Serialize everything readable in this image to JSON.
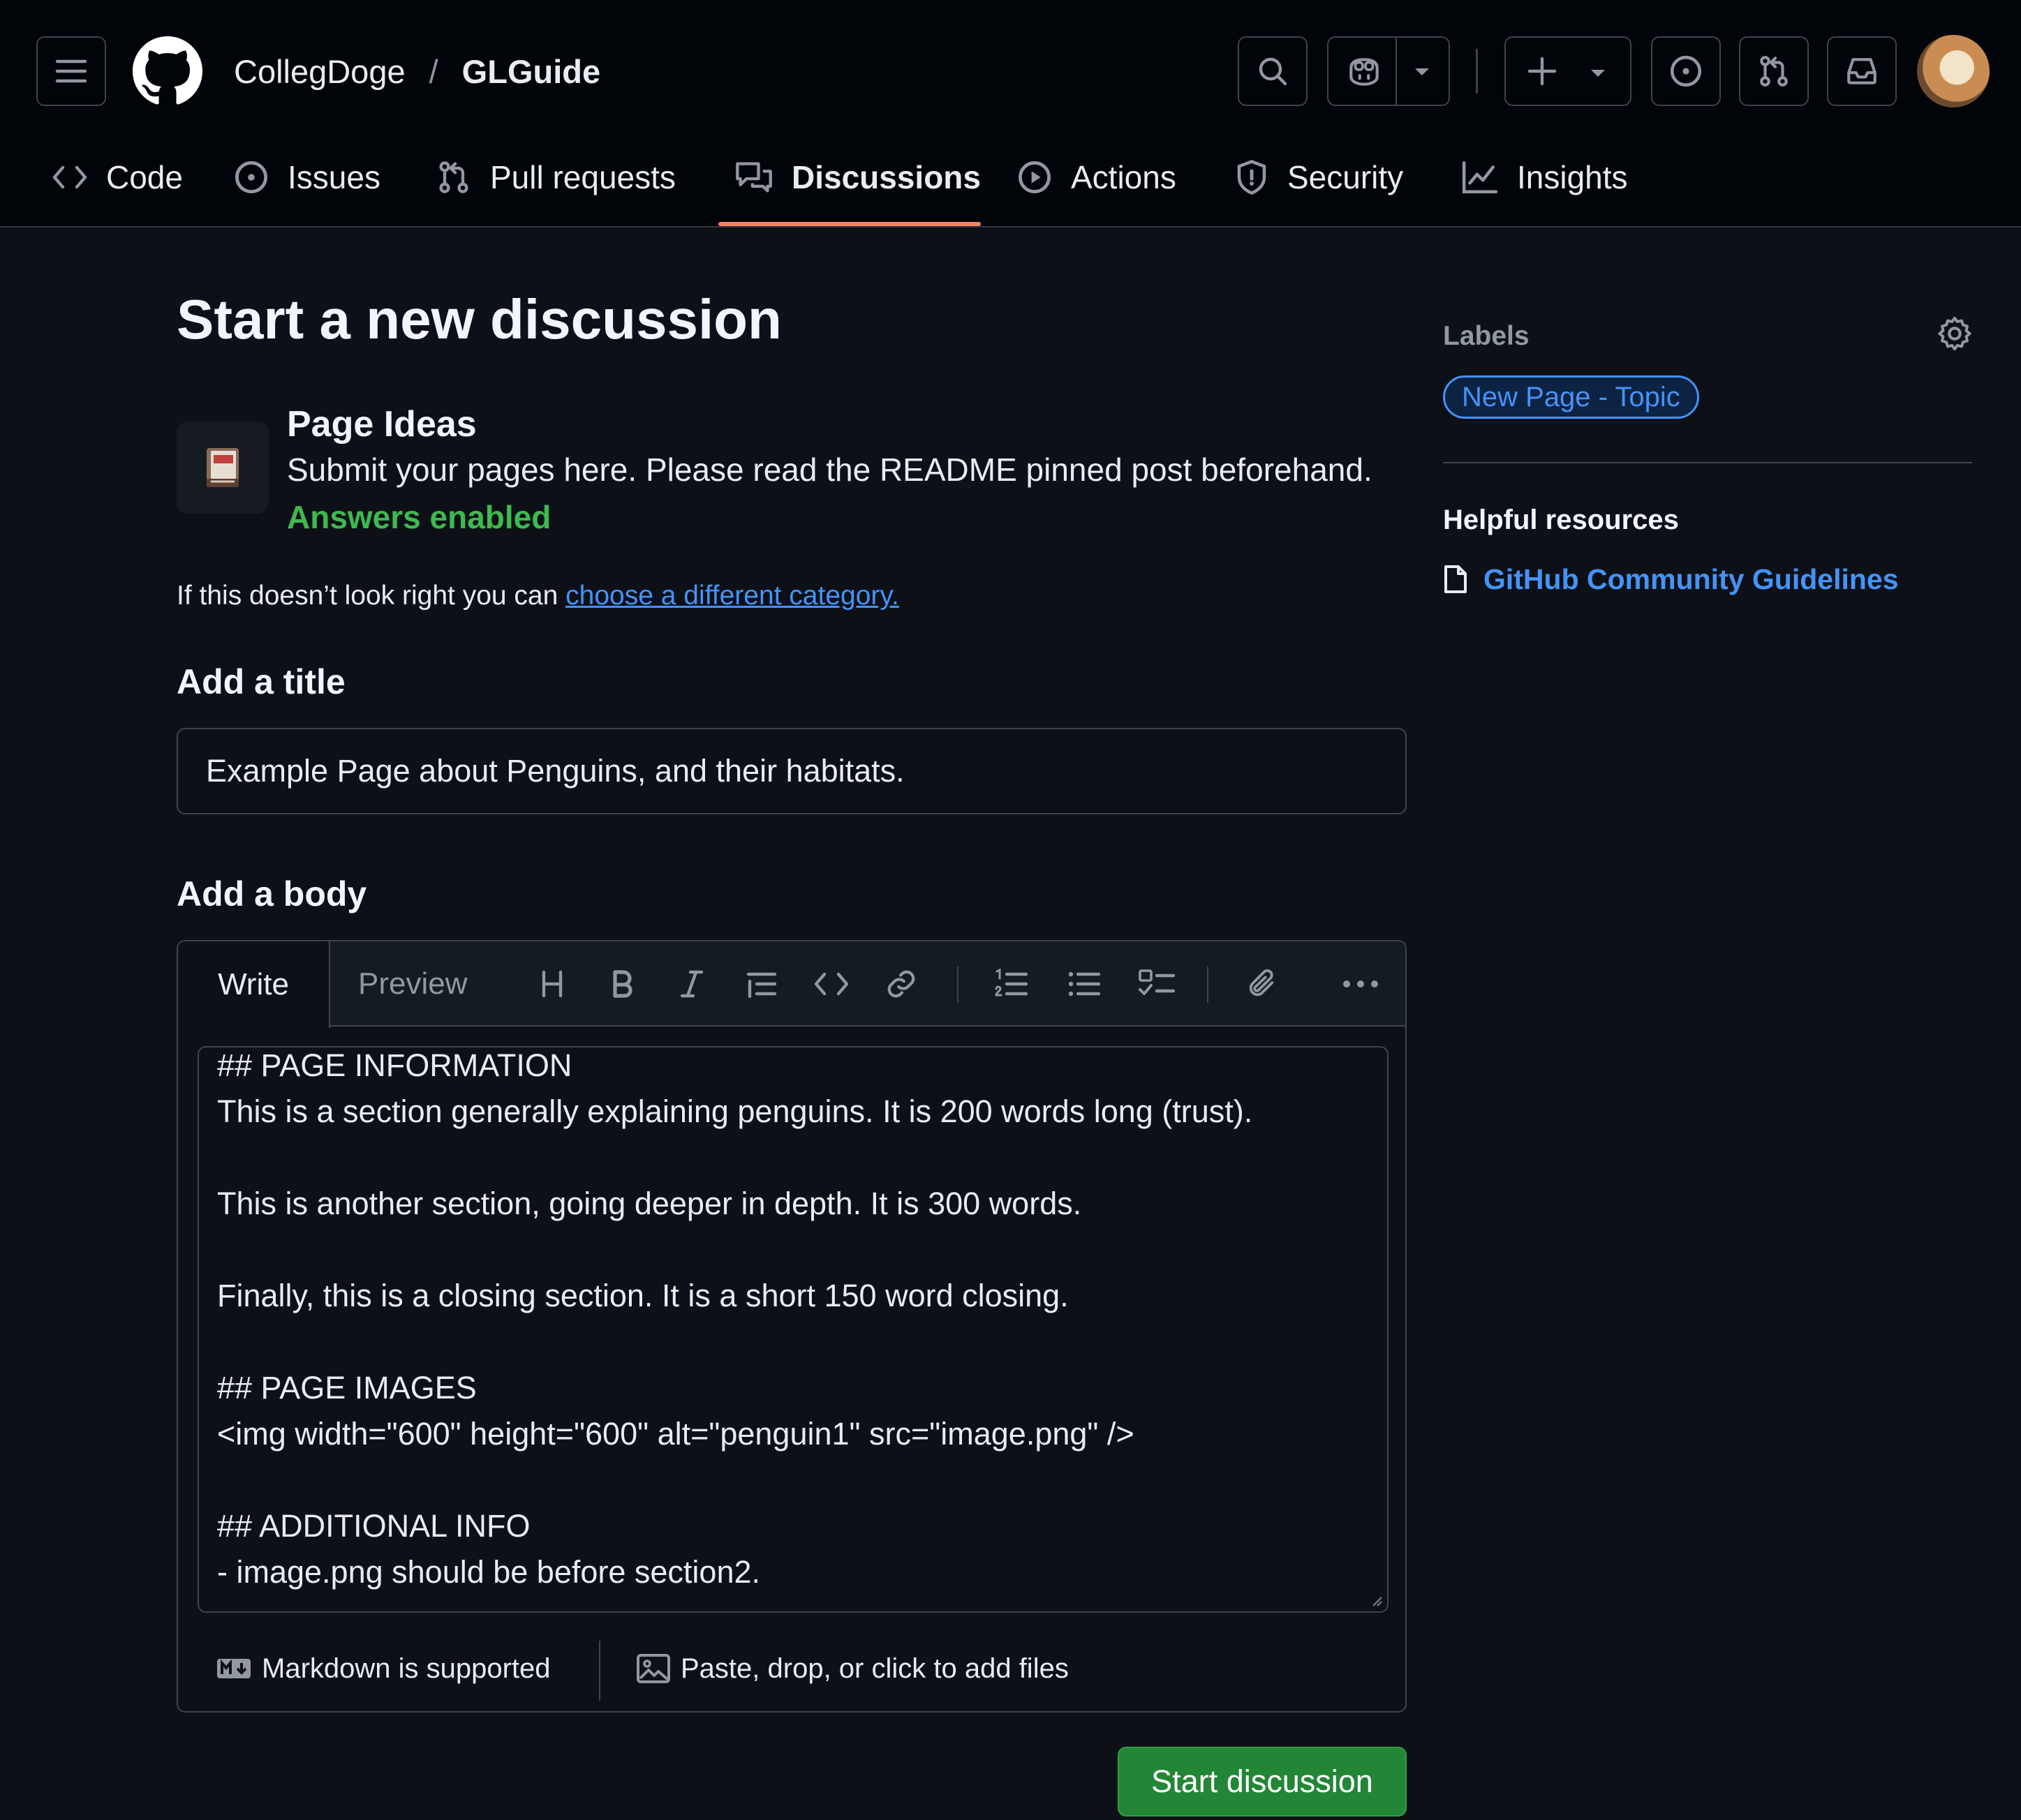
{
  "header": {
    "owner": "CollegDoge",
    "separator": "/",
    "repo": "GLGuide"
  },
  "tabs": [
    {
      "label": "Code",
      "icon": "code-icon"
    },
    {
      "label": "Issues",
      "icon": "issue-icon"
    },
    {
      "label": "Pull requests",
      "icon": "pull-request-icon"
    },
    {
      "label": "Discussions",
      "icon": "discussion-icon",
      "active": true
    },
    {
      "label": "Actions",
      "icon": "play-icon"
    },
    {
      "label": "Security",
      "icon": "shield-icon"
    },
    {
      "label": "Insights",
      "icon": "graph-icon"
    }
  ],
  "main": {
    "title": "Start a new discussion",
    "category": {
      "name": "Page Ideas",
      "description": "Submit your pages here. Please read the README pinned post beforehand.",
      "answers": "Answers enabled",
      "emoji": "notebook-icon"
    },
    "wrong_category_prefix": "If this doesn’t look right you can ",
    "wrong_category_link": "choose a different category.",
    "title_label": "Add a title",
    "title_value": "Example Page about Penguins, and their habitats.",
    "body_label": "Add a body"
  },
  "editor": {
    "write_tab": "Write",
    "preview_tab": "Preview",
    "body_lines": [
      "## PAGE INFORMATION",
      "This is a section generally explaining penguins. It is 200 words long (trust).",
      "",
      "This is another section, going deeper in depth. It is 300 words.",
      "",
      "Finally, this is a closing section. It is a short 150 word closing.",
      "",
      "## PAGE IMAGES",
      "<img width=\"600\" height=\"600\" alt=\"penguin1\" src=\"image.png\" />",
      "",
      "## ADDITIONAL INFO",
      "- image.png should be before section2."
    ],
    "markdown_note": "Markdown is supported",
    "files_note": "Paste, drop, or click to add files"
  },
  "actions": {
    "start_button": "Start discussion"
  },
  "sidebar": {
    "labels_heading": "Labels",
    "label_pill": "New Page - Topic",
    "resources_heading": "Helpful resources",
    "resource_link": "GitHub Community Guidelines"
  },
  "colors": {
    "accent_link": "#4493f8",
    "active_tab_underline": "#f78166",
    "answers_green": "#3fb950",
    "primary_button": "#238636"
  }
}
